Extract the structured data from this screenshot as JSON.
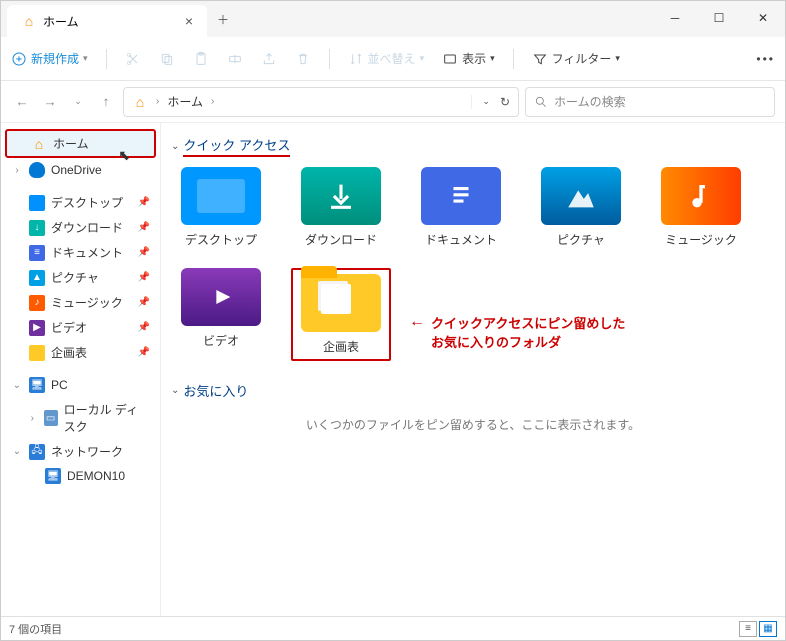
{
  "tab": {
    "title": "ホーム"
  },
  "toolbar": {
    "new": "新規作成",
    "sort": "並べ替え",
    "view": "表示",
    "filter": "フィルター"
  },
  "breadcrumb": {
    "root": "ホーム"
  },
  "search": {
    "placeholder": "ホームの検索"
  },
  "sidebar": {
    "home": "ホーム",
    "onedrive": "OneDrive",
    "desktop": "デスクトップ",
    "downloads": "ダウンロード",
    "documents": "ドキュメント",
    "pictures": "ピクチャ",
    "music": "ミュージック",
    "videos": "ビデオ",
    "plan": "企画表",
    "pc": "PC",
    "localdisk": "ローカル ディスク",
    "network": "ネットワーク",
    "demon10": "DEMON10"
  },
  "sections": {
    "quickaccess": "クイック アクセス",
    "favorites": "お気に入り",
    "favorites_empty": "いくつかのファイルをピン留めすると、ここに表示されます。"
  },
  "tiles": {
    "desktop": "デスクトップ",
    "downloads": "ダウンロード",
    "documents": "ドキュメント",
    "pictures": "ピクチャ",
    "music": "ミュージック",
    "videos": "ビデオ",
    "plan": "企画表"
  },
  "annotation": {
    "line1": "クイックアクセスにピン留めした",
    "line2": "お気に入りのフォルダ"
  },
  "status": {
    "count": "7 個の項目"
  }
}
